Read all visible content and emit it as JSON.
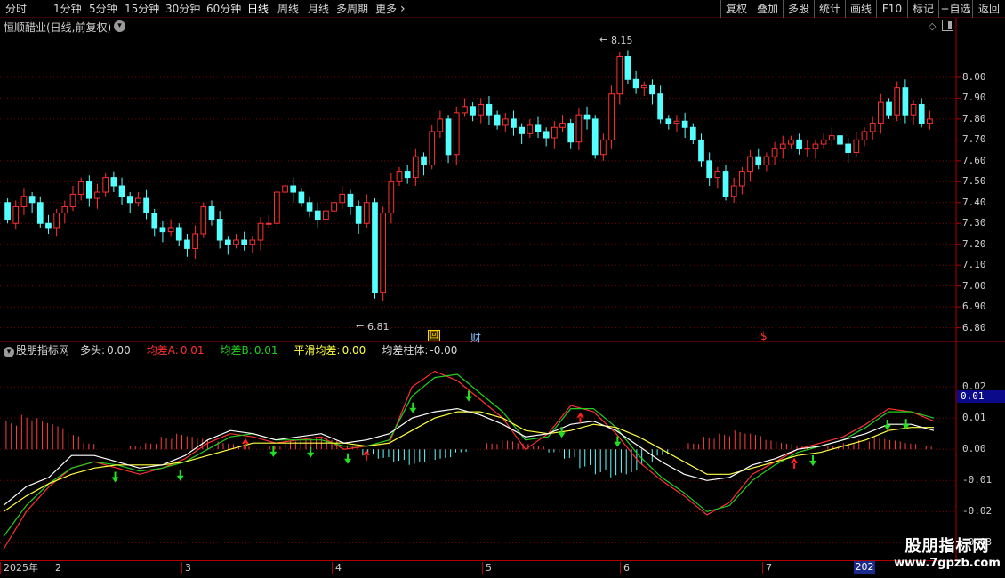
{
  "toolbar": {
    "periods": [
      "分时",
      "1分钟",
      "5分钟",
      "15分钟",
      "30分钟",
      "60分钟",
      "日线",
      "周线",
      "月线",
      "多周期",
      "更多"
    ],
    "active": "日线",
    "more_icon": "chevron-right-icon",
    "right_buttons": [
      "复权",
      "叠加",
      "多股",
      "统计",
      "画线",
      "F10",
      "标记",
      "+自选",
      "返回"
    ]
  },
  "main_chart": {
    "title": "恒顺醋业(日线,前复权)",
    "high_label": "8.15",
    "low_label": "6.81",
    "markers": [
      "回",
      "财",
      "$"
    ],
    "price_axis": [
      "8.00",
      "7.90",
      "7.80",
      "7.70",
      "7.60",
      "7.50",
      "7.40",
      "7.30",
      "7.20",
      "7.10",
      "7.00",
      "6.90",
      "6.80"
    ]
  },
  "indicator": {
    "name": "股朋指标网",
    "items": [
      {
        "label": "多头:",
        "value": "0.00",
        "color": "#d8d8d8"
      },
      {
        "label": "均差A:",
        "value": "0.01",
        "color": "#ff3030"
      },
      {
        "label": "均差B:",
        "value": "0.01",
        "color": "#20d020"
      },
      {
        "label": "平滑均差:",
        "value": "0.00",
        "color": "#ffff40"
      },
      {
        "label": "均差柱体:",
        "value": "-0.00",
        "color": "#d8d8d8"
      }
    ],
    "axis": [
      "0.02",
      "0.01",
      "0.00",
      "-0.01",
      "-0.02",
      "-0.03"
    ],
    "current_value": "0.01"
  },
  "date_axis": {
    "ticks": [
      "2025年",
      "2",
      "3",
      "4",
      "5",
      "6",
      "7"
    ],
    "end_label": "202"
  },
  "watermark": {
    "title": "股朋指标网",
    "url": "www.7gpzb.com"
  },
  "colors": {
    "up": "#ff3030",
    "down": "#54ffff",
    "grid": "#7a0000",
    "axis": "#b00000"
  },
  "chart_data": [
    {
      "type": "candlestick",
      "title": "恒顺醋业(日线,前复权)",
      "ylim": [
        6.76,
        8.2
      ],
      "y_ticks": [
        6.8,
        6.9,
        7.0,
        7.1,
        7.2,
        7.3,
        7.4,
        7.5,
        7.6,
        7.7,
        7.8,
        7.9,
        8.0
      ],
      "x_labels": [
        "2025年",
        "2",
        "3",
        "4",
        "5",
        "6",
        "7"
      ],
      "annotations": [
        {
          "text": "8.15",
          "value": 8.15
        },
        {
          "text": "6.81",
          "value": 6.81
        }
      ],
      "close": [
        7.32,
        7.38,
        7.43,
        7.4,
        7.3,
        7.28,
        7.35,
        7.38,
        7.44,
        7.5,
        7.42,
        7.45,
        7.52,
        7.48,
        7.43,
        7.4,
        7.42,
        7.35,
        7.28,
        7.26,
        7.28,
        7.22,
        7.18,
        7.25,
        7.38,
        7.32,
        7.22,
        7.2,
        7.22,
        7.2,
        7.22,
        7.3,
        7.3,
        7.45,
        7.48,
        7.45,
        7.4,
        7.36,
        7.32,
        7.36,
        7.4,
        7.44,
        7.38,
        7.3,
        7.4,
        6.97,
        7.35,
        7.5,
        7.55,
        7.52,
        7.62,
        7.58,
        7.74,
        7.8,
        7.63,
        7.83,
        7.86,
        7.82,
        7.87,
        7.82,
        7.77,
        7.8,
        7.76,
        7.73,
        7.77,
        7.74,
        7.71,
        7.76,
        7.78,
        7.69,
        7.82,
        7.8,
        7.63,
        7.7,
        7.92,
        8.1,
        7.99,
        7.95,
        7.96,
        7.92,
        7.8,
        7.78,
        7.79,
        7.76,
        7.7,
        7.6,
        7.52,
        7.55,
        7.43,
        7.48,
        7.55,
        7.62,
        7.58,
        7.62,
        7.66,
        7.68,
        7.7,
        7.66,
        7.66,
        7.68,
        7.7,
        7.72,
        7.68,
        7.64,
        7.7,
        7.74,
        7.78,
        7.88,
        7.82,
        7.95,
        7.82,
        7.87,
        7.78,
        7.8
      ],
      "open": [
        7.4,
        7.3,
        7.38,
        7.43,
        7.4,
        7.3,
        7.28,
        7.35,
        7.38,
        7.44,
        7.5,
        7.42,
        7.45,
        7.52,
        7.48,
        7.43,
        7.4,
        7.42,
        7.35,
        7.28,
        7.26,
        7.28,
        7.22,
        7.18,
        7.25,
        7.38,
        7.32,
        7.22,
        7.2,
        7.22,
        7.2,
        7.22,
        7.3,
        7.3,
        7.45,
        7.48,
        7.45,
        7.4,
        7.36,
        7.32,
        7.36,
        7.4,
        7.44,
        7.38,
        7.3,
        7.4,
        6.97,
        7.35,
        7.5,
        7.55,
        7.52,
        7.62,
        7.58,
        7.74,
        7.8,
        7.63,
        7.83,
        7.86,
        7.82,
        7.87,
        7.82,
        7.77,
        7.8,
        7.76,
        7.73,
        7.77,
        7.74,
        7.71,
        7.76,
        7.78,
        7.69,
        7.82,
        7.8,
        7.63,
        7.7,
        7.92,
        8.1,
        7.99,
        7.95,
        7.96,
        7.92,
        7.8,
        7.78,
        7.79,
        7.76,
        7.7,
        7.6,
        7.52,
        7.55,
        7.43,
        7.48,
        7.55,
        7.62,
        7.58,
        7.62,
        7.66,
        7.68,
        7.7,
        7.66,
        7.66,
        7.68,
        7.7,
        7.72,
        7.68,
        7.64,
        7.7,
        7.74,
        7.78,
        7.88,
        7.82,
        7.95,
        7.82,
        7.87,
        7.78
      ]
    },
    {
      "type": "line",
      "title": "股朋指标网",
      "ylim": [
        -0.035,
        0.03
      ],
      "y_ticks": [
        0.02,
        0.01,
        0.0,
        -0.01,
        -0.02,
        -0.03
      ],
      "series": [
        {
          "name": "均差A",
          "color": "#ff3030",
          "values": [
            -0.032,
            -0.02,
            -0.012,
            -0.006,
            -0.004,
            -0.006,
            -0.008,
            -0.006,
            -0.003,
            0.002,
            0.005,
            0.004,
            0.002,
            0.003,
            0.004,
            0.0,
            0.001,
            0.002,
            0.02,
            0.025,
            0.022,
            0.016,
            0.01,
            0.0,
            0.005,
            0.014,
            0.012,
            0.005,
            -0.004,
            -0.01,
            -0.015,
            -0.021,
            -0.017,
            -0.008,
            -0.004,
            0.0,
            0.002,
            0.004,
            0.008,
            0.013,
            0.012,
            0.009
          ]
        },
        {
          "name": "均差B",
          "color": "#20d020",
          "values": [
            -0.028,
            -0.018,
            -0.011,
            -0.006,
            -0.004,
            -0.005,
            -0.007,
            -0.006,
            -0.004,
            0.0,
            0.004,
            0.005,
            0.003,
            0.003,
            0.003,
            0.001,
            0.001,
            0.003,
            0.017,
            0.023,
            0.024,
            0.018,
            0.012,
            0.003,
            0.004,
            0.013,
            0.013,
            0.007,
            -0.002,
            -0.009,
            -0.014,
            -0.02,
            -0.018,
            -0.01,
            -0.005,
            -0.001,
            0.001,
            0.003,
            0.007,
            0.012,
            0.012,
            0.01
          ]
        },
        {
          "name": "平滑均差",
          "color": "#ffff40",
          "values": [
            -0.02,
            -0.015,
            -0.011,
            -0.008,
            -0.006,
            -0.005,
            -0.005,
            -0.005,
            -0.004,
            -0.002,
            0.0,
            0.002,
            0.002,
            0.002,
            0.002,
            0.002,
            0.001,
            0.002,
            0.006,
            0.01,
            0.012,
            0.012,
            0.01,
            0.006,
            0.005,
            0.006,
            0.008,
            0.007,
            0.004,
            0.0,
            -0.004,
            -0.008,
            -0.008,
            -0.006,
            -0.004,
            -0.002,
            -0.001,
            0.001,
            0.003,
            0.006,
            0.007,
            0.007
          ]
        },
        {
          "name": "多头",
          "color": "#ffffff",
          "values": [
            -0.018,
            -0.012,
            -0.009,
            -0.002,
            -0.002,
            -0.004,
            -0.006,
            -0.005,
            -0.002,
            0.003,
            0.006,
            0.005,
            0.003,
            0.004,
            0.005,
            0.002,
            0.003,
            0.005,
            0.01,
            0.012,
            0.013,
            0.011,
            0.008,
            0.004,
            0.005,
            0.008,
            0.009,
            0.006,
            0.001,
            -0.004,
            -0.008,
            -0.01,
            -0.009,
            -0.005,
            -0.003,
            0.0,
            0.001,
            0.003,
            0.005,
            0.008,
            0.008,
            0.006
          ]
        }
      ],
      "histogram": [
        0.009,
        0.011,
        0.01,
        0.008,
        0.005,
        0.002,
        0.0,
        0.0,
        0.001,
        0.002,
        0.004,
        0.005,
        0.004,
        0.003,
        0.002,
        0.001,
        0.0,
        0.001,
        0.003,
        0.004,
        0.004,
        0.003,
        0.001,
        -0.002,
        -0.003,
        -0.004,
        -0.005,
        -0.004,
        -0.003,
        -0.001,
        0.0,
        0.002,
        0.003,
        0.002,
        0.001,
        -0.001,
        -0.003,
        -0.006,
        -0.008,
        -0.009,
        -0.008,
        -0.005,
        -0.002,
        0.0,
        0.002,
        0.004,
        0.005,
        0.006,
        0.005,
        0.003,
        0.002,
        0.001,
        0.0,
        0.001,
        0.002,
        0.003,
        0.004,
        0.003,
        0.002,
        0.001
      ],
      "down_arrows": [
        0.12,
        0.19,
        0.29,
        0.33,
        0.37,
        0.44,
        0.5,
        0.6,
        0.66,
        0.87,
        0.95,
        0.97
      ],
      "up_arrows": [
        0.26,
        0.39,
        0.62,
        0.85
      ]
    }
  ]
}
